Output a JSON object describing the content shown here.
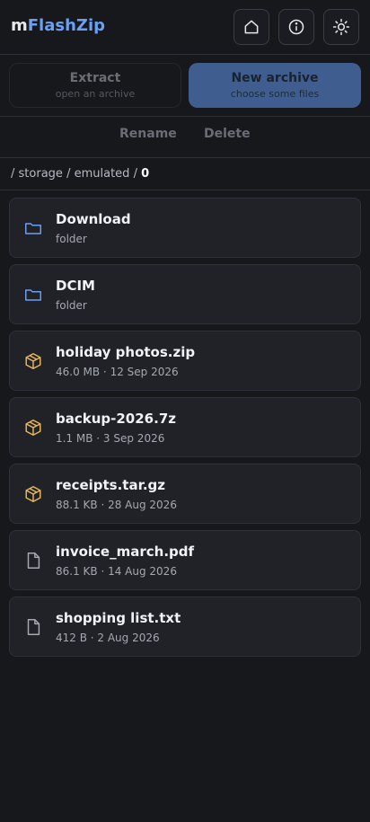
{
  "app": {
    "brand_prefix": "m",
    "brand_name": "FlashZip"
  },
  "header": {
    "buttons": [
      "home-icon",
      "info-icon",
      "sun-icon"
    ]
  },
  "actions": {
    "extract": {
      "title": "Extract",
      "subtitle": "open an archive"
    },
    "new_archive": {
      "title": "New archive",
      "subtitle": "choose some files"
    }
  },
  "file_ops": {
    "rename": "Rename",
    "delete": "Delete"
  },
  "breadcrumb": {
    "parts": [
      "/",
      "storage",
      "/",
      "emulated",
      "/"
    ],
    "current": "0"
  },
  "files": [
    {
      "name": "Download",
      "meta": "folder",
      "icon": "folder-icon"
    },
    {
      "name": "DCIM",
      "meta": "folder",
      "icon": "folder-icon"
    },
    {
      "name": "holiday photos.zip",
      "meta": "46.0 MB · 12 Sep 2026",
      "icon": "archive-icon"
    },
    {
      "name": "backup-2026.7z",
      "meta": "1.1 MB · 3 Sep 2026",
      "icon": "archive-icon"
    },
    {
      "name": "receipts.tar.gz",
      "meta": "88.1 KB · 28 Aug 2026",
      "icon": "archive-icon"
    },
    {
      "name": "invoice_march.pdf",
      "meta": "86.1 KB · 14 Aug 2026",
      "icon": "file-icon"
    },
    {
      "name": "shopping list.txt",
      "meta": "412 B · 2 Aug 2026",
      "icon": "file-icon"
    }
  ],
  "colors": {
    "accent": "#6b9ff2",
    "archive": "#e8b65a",
    "folder": "#6b9ff2",
    "file": "#a5a8b0"
  }
}
